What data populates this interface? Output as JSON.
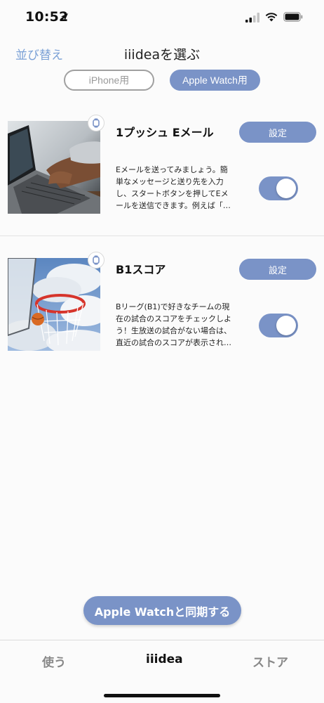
{
  "status_bar": {
    "time": "10:52"
  },
  "nav": {
    "sort_label": "並び替え",
    "title": "iiideaを選ぶ"
  },
  "segment": {
    "iphone_label": "iPhone用",
    "watch_label": "Apple Watch用",
    "selected": "Apple Watch用"
  },
  "items": [
    {
      "title": "1プッシュ Eメール",
      "description": "Eメールを送ってみましょう。簡単なメッセージと送り先を入力し、スタートボタンを押してEメールを送信できます。例えば「…",
      "setting_label": "設定",
      "enabled": true
    },
    {
      "title": "B1スコア",
      "description": "Bリーグ(B1)で好きなチームの現在の試合のスコアをチェックしよう！生放送の試合がない場合は、直近の試合のスコアが表示され…",
      "setting_label": "設定",
      "enabled": true
    }
  ],
  "sync_button": {
    "label": "Apple Watchと同期する"
  },
  "tabs": [
    {
      "label": "使う"
    },
    {
      "label": "iiidea"
    },
    {
      "label": "ストア"
    }
  ],
  "colors": {
    "accent": "#7a93c7",
    "link": "#7ba1d6",
    "background": "#fbfbfb"
  },
  "icons": {
    "location": "location-arrow-icon",
    "signal": "cellular-signal-icon",
    "wifi": "wifi-icon",
    "battery": "battery-icon",
    "watch_badge": "apple-watch-icon"
  }
}
